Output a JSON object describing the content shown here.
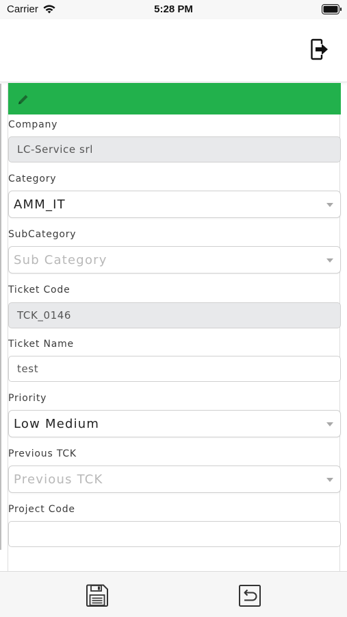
{
  "status_bar": {
    "carrier": "Carrier",
    "time": "5:28 PM"
  },
  "header": {
    "action_icon": "logout-icon"
  },
  "card": {
    "header_icon": "pencil-icon",
    "header_color": "#22b14c"
  },
  "form": {
    "company": {
      "label": "Company",
      "value": "LC-Service srl"
    },
    "category": {
      "label": "Category",
      "value": "AMM_IT"
    },
    "subcategory": {
      "label": "SubCategory",
      "placeholder": "Sub Category"
    },
    "ticket_code": {
      "label": "Ticket Code",
      "value": "TCK_0146"
    },
    "ticket_name": {
      "label": "Ticket Name",
      "value": "test"
    },
    "priority": {
      "label": "Priority",
      "value": "Low Medium"
    },
    "previous_tck": {
      "label": "Previous TCK",
      "placeholder": "Previous TCK"
    },
    "project_code": {
      "label": "Project Code",
      "value": ""
    }
  },
  "toolbar": {
    "save_icon": "floppy-disk-icon",
    "undo_icon": "undo-icon"
  }
}
